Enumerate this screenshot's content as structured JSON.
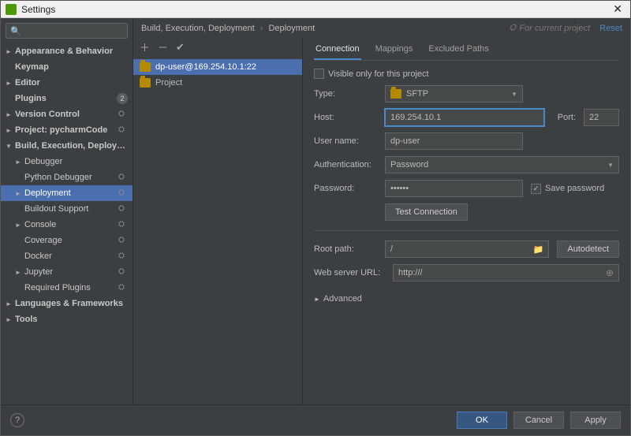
{
  "window": {
    "title": "Settings"
  },
  "search": {
    "placeholder": ""
  },
  "sidebar": {
    "items": [
      {
        "label": "Appearance & Behavior",
        "depth": 0,
        "arrow": "►",
        "bold": true
      },
      {
        "label": "Keymap",
        "depth": 0,
        "bold": true,
        "noarrow": true
      },
      {
        "label": "Editor",
        "depth": 0,
        "arrow": "►",
        "bold": true
      },
      {
        "label": "Plugins",
        "depth": 0,
        "bold": true,
        "noarrow": true,
        "badge": "2"
      },
      {
        "label": "Version Control",
        "depth": 0,
        "arrow": "►",
        "bold": true,
        "ws": true
      },
      {
        "label": "Project: pycharmCode",
        "depth": 0,
        "arrow": "►",
        "bold": true,
        "ws": true
      },
      {
        "label": "Build, Execution, Deployment",
        "depth": 0,
        "arrow": "▼",
        "bold": true
      },
      {
        "label": "Debugger",
        "depth": 1,
        "arrow": "►"
      },
      {
        "label": "Python Debugger",
        "depth": 1,
        "noarrow": true,
        "ws": true
      },
      {
        "label": "Deployment",
        "depth": 1,
        "arrow": "►",
        "sel": true,
        "ws": true
      },
      {
        "label": "Buildout Support",
        "depth": 1,
        "noarrow": true,
        "ws": true
      },
      {
        "label": "Console",
        "depth": 1,
        "arrow": "►",
        "ws": true
      },
      {
        "label": "Coverage",
        "depth": 1,
        "noarrow": true,
        "ws": true
      },
      {
        "label": "Docker",
        "depth": 1,
        "noarrow": true,
        "ws": true
      },
      {
        "label": "Jupyter",
        "depth": 1,
        "arrow": "►",
        "ws": true
      },
      {
        "label": "Required Plugins",
        "depth": 1,
        "noarrow": true,
        "ws": true
      },
      {
        "label": "Languages & Frameworks",
        "depth": 0,
        "arrow": "►",
        "bold": true
      },
      {
        "label": "Tools",
        "depth": 0,
        "arrow": "►",
        "bold": true
      }
    ]
  },
  "breadcrumb": {
    "a": "Build, Execution, Deployment",
    "b": "Deployment"
  },
  "hint": "For current project",
  "reset": "Reset",
  "servers": [
    {
      "label": "dp-user@169.254.10.1:22",
      "sel": true
    },
    {
      "label": "Project"
    }
  ],
  "tabs": {
    "connection": "Connection",
    "mappings": "Mappings",
    "excluded": "Excluded Paths"
  },
  "form": {
    "visible_only": "Visible only for this project",
    "type_label": "Type:",
    "type_value": "SFTP",
    "host_label": "Host:",
    "host_value": "169.254.10.1",
    "port_label": "Port:",
    "port_value": "22",
    "user_label": "User name:",
    "user_value": "dp-user",
    "auth_label": "Authentication:",
    "auth_value": "Password",
    "pwd_label": "Password:",
    "pwd_value": "••••••",
    "save_pwd": "Save password",
    "test": "Test Connection",
    "root_label": "Root path:",
    "root_value": "/",
    "autodetect": "Autodetect",
    "url_label": "Web server URL:",
    "url_value": "http:///",
    "advanced": "Advanced"
  },
  "footer": {
    "ok": "OK",
    "cancel": "Cancel",
    "apply": "Apply",
    "help": "?"
  }
}
